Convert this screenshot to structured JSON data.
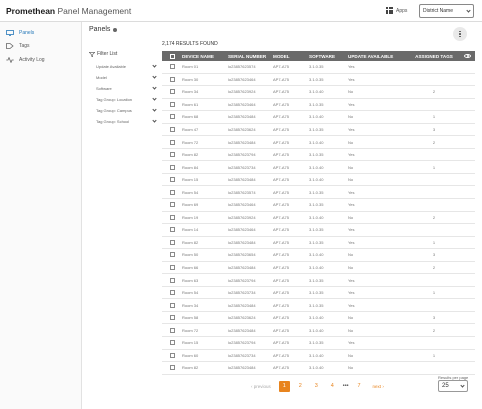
{
  "header": {
    "brand_primary": "Promethean",
    "brand_secondary": "Panel Management",
    "apps_label": "Apps",
    "district_label": "District Name"
  },
  "sidebar": {
    "items": [
      {
        "label": "Panels",
        "icon": "monitor-icon",
        "active": true
      },
      {
        "label": "Tags",
        "icon": "tag-icon",
        "active": false
      },
      {
        "label": "Activity Log",
        "icon": "activity-icon",
        "active": false
      }
    ]
  },
  "main": {
    "title": "Panels",
    "results_text": "2,174 RESULTS FOUND"
  },
  "filters": {
    "title": "Filter List",
    "items": [
      "Update Available",
      "Model",
      "Software",
      "Tag Group: Location",
      "Tag Group: Campus",
      "Tag Group: School"
    ]
  },
  "table": {
    "columns": [
      "DEVICE NAME",
      "SERIAL NUMBER",
      "MODEL",
      "SOFTWARE",
      "UPDATE AVAILABLE",
      "ASSIGNED TAGS"
    ],
    "rows": [
      {
        "name": "Room 01",
        "serial": "lo23857623574",
        "model": "AP7-A75",
        "software": "3.1.0.35",
        "update": "Yes",
        "tags": ""
      },
      {
        "name": "Room 30",
        "serial": "lo23857623464",
        "model": "AP7-A75",
        "software": "3.1.0.35",
        "update": "Yes",
        "tags": ""
      },
      {
        "name": "Room 34",
        "serial": "lo23857623924",
        "model": "AP7-A75",
        "software": "3.1.0.40",
        "update": "No",
        "tags": "2"
      },
      {
        "name": "Room 61",
        "serial": "lo23857623464",
        "model": "AP7-A75",
        "software": "3.1.0.35",
        "update": "Yes",
        "tags": ""
      },
      {
        "name": "Room 68",
        "serial": "lo23857623484",
        "model": "AP7-A75",
        "software": "3.1.0.40",
        "update": "No",
        "tags": "1"
      },
      {
        "name": "Room 47",
        "serial": "lo23857623624",
        "model": "AP7-A75",
        "software": "3.1.0.35",
        "update": "Yes",
        "tags": "3"
      },
      {
        "name": "Room 72",
        "serial": "lo23857623484",
        "model": "AP7-A75",
        "software": "3.1.0.40",
        "update": "No",
        "tags": "2"
      },
      {
        "name": "Room 82",
        "serial": "lo23857623794",
        "model": "AP7-A75",
        "software": "3.1.0.35",
        "update": "Yes",
        "tags": ""
      },
      {
        "name": "Room 84",
        "serial": "lo23857623734",
        "model": "AP7-A75",
        "software": "3.1.0.40",
        "update": "No",
        "tags": "1"
      },
      {
        "name": "Room 15",
        "serial": "lo23857623484",
        "model": "AP7-A75",
        "software": "3.1.0.40",
        "update": "No",
        "tags": ""
      },
      {
        "name": "Room 54",
        "serial": "lo23857623574",
        "model": "AP7-A75",
        "software": "3.1.0.35",
        "update": "Yes",
        "tags": ""
      },
      {
        "name": "Room 69",
        "serial": "lo23857623464",
        "model": "AP7-A75",
        "software": "3.1.0.35",
        "update": "Yes",
        "tags": ""
      },
      {
        "name": "Room 19",
        "serial": "lo23857623924",
        "model": "AP7-A75",
        "software": "3.1.0.40",
        "update": "No",
        "tags": "2"
      },
      {
        "name": "Room 14",
        "serial": "lo23857623464",
        "model": "AP7-A75",
        "software": "3.1.0.35",
        "update": "Yes",
        "tags": ""
      },
      {
        "name": "Room 82",
        "serial": "lo23857623484",
        "model": "AP7-A75",
        "software": "3.1.0.35",
        "update": "Yes",
        "tags": "1"
      },
      {
        "name": "Room 50",
        "serial": "lo23857623654",
        "model": "AP7-A75",
        "software": "3.1.0.40",
        "update": "No",
        "tags": "3"
      },
      {
        "name": "Room 66",
        "serial": "lo23857623484",
        "model": "AP7-A75",
        "software": "3.1.0.40",
        "update": "No",
        "tags": "2"
      },
      {
        "name": "Room 63",
        "serial": "lo23857623794",
        "model": "AP7-A75",
        "software": "3.1.0.35",
        "update": "Yes",
        "tags": ""
      },
      {
        "name": "Room 54",
        "serial": "lo23857623734",
        "model": "AP7-A75",
        "software": "3.1.0.35",
        "update": "Yes",
        "tags": "1"
      },
      {
        "name": "Room 34",
        "serial": "lo23857623484",
        "model": "AP7-A75",
        "software": "3.1.0.35",
        "update": "Yes",
        "tags": ""
      },
      {
        "name": "Room 58",
        "serial": "lo23857623624",
        "model": "AP7-A75",
        "software": "3.1.0.40",
        "update": "No",
        "tags": "3"
      },
      {
        "name": "Room 72",
        "serial": "lo23857623484",
        "model": "AP7-A75",
        "software": "3.1.0.40",
        "update": "No",
        "tags": "2"
      },
      {
        "name": "Room 15",
        "serial": "lo23857623794",
        "model": "AP7-A75",
        "software": "3.1.0.35",
        "update": "Yes",
        "tags": ""
      },
      {
        "name": "Room 60",
        "serial": "lo23857623734",
        "model": "AP7-A75",
        "software": "3.1.0.40",
        "update": "No",
        "tags": "1"
      },
      {
        "name": "Room 82",
        "serial": "lo23857623484",
        "model": "AP7-A75",
        "software": "3.1.0.40",
        "update": "No",
        "tags": ""
      }
    ]
  },
  "pagination": {
    "prev_label": "previous",
    "pages": [
      "1",
      "2",
      "3",
      "4"
    ],
    "ellipsis": "•••",
    "last_page": "7",
    "next_label": "next",
    "current": "1"
  },
  "results_per_page": {
    "label": "Results per page",
    "value": "25"
  },
  "colors": {
    "accent": "#e8841e",
    "active_nav": "#2779b9",
    "table_header": "#6a6a6a"
  }
}
